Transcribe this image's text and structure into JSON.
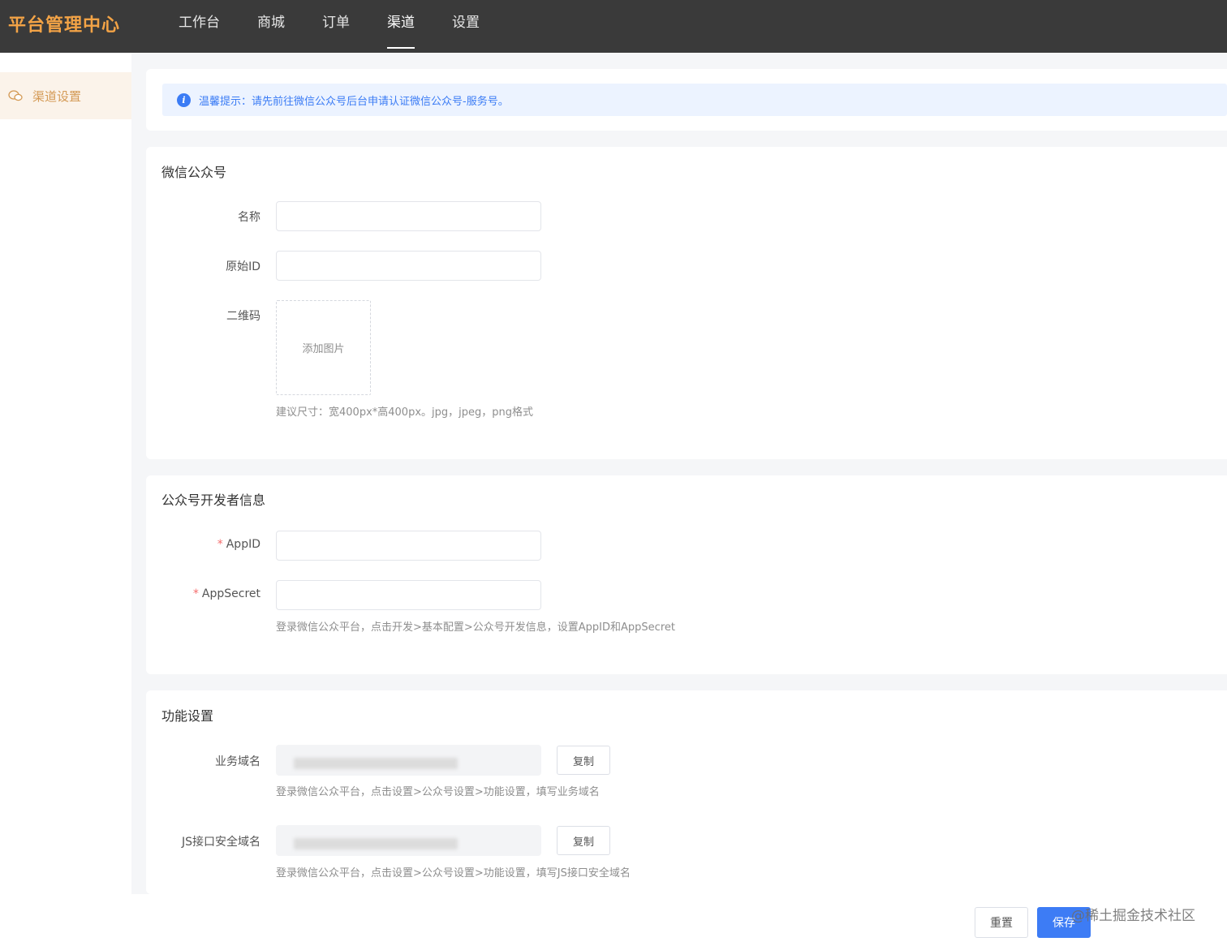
{
  "header": {
    "brand": "平台管理中心",
    "nav": [
      {
        "label": "工作台"
      },
      {
        "label": "商城"
      },
      {
        "label": "订单"
      },
      {
        "label": "渠道"
      },
      {
        "label": "设置"
      }
    ],
    "active_nav": "渠道"
  },
  "sidebar": {
    "items": [
      {
        "label": "渠道设置",
        "icon": "wechat-icon"
      }
    ]
  },
  "tip": {
    "text": "温馨提示：请先前往微信公众号后台申请认证微信公众号-服务号。",
    "icon": "info-icon"
  },
  "wechat_section": {
    "title": "微信公众号",
    "name_label": "名称",
    "name_value": "",
    "original_id_label": "原始ID",
    "original_id_value": "",
    "qrcode_label": "二维码",
    "upload_label": "添加图片",
    "upload_hint": "建议尺寸：宽400px*高400px。jpg，jpeg，png格式"
  },
  "dev_section": {
    "title": "公众号开发者信息",
    "appid_required": "*",
    "appid_label": "AppID",
    "appid_value": "",
    "appsecret_required": "*",
    "appsecret_label": "AppSecret",
    "appsecret_value": "",
    "hint": "登录微信公众平台，点击开发>基本配置>公众号开发信息，设置AppID和AppSecret"
  },
  "func_section": {
    "title": "功能设置",
    "biz_domain_label": "业务域名",
    "biz_domain_copy": "复制",
    "biz_domain_hint": "登录微信公众平台，点击设置>公众号设置>功能设置，填写业务域名",
    "js_domain_label": "JS接口安全域名",
    "js_domain_copy": "复制",
    "js_domain_hint": "登录微信公众平台，点击设置>公众号设置>功能设置，填写JS接口安全域名"
  },
  "footer": {
    "reset_label": "重置",
    "save_label": "保存"
  },
  "watermark": "@稀土掘金技术社区"
}
